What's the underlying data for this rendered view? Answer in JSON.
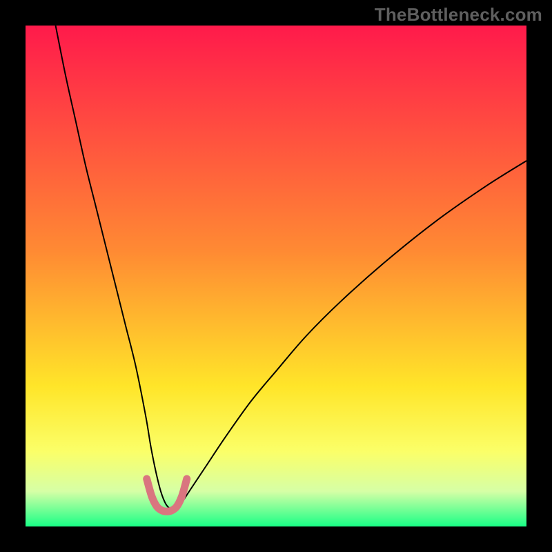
{
  "watermark": "TheBottleneck.com",
  "chart_data": {
    "type": "line",
    "title": "",
    "xlabel": "",
    "ylabel": "",
    "xlim": [
      0,
      100
    ],
    "ylim": [
      0,
      100
    ],
    "gradient_stops": [
      {
        "offset": 0,
        "color": "#ff1a4b"
      },
      {
        "offset": 45,
        "color": "#ff8a33"
      },
      {
        "offset": 72,
        "color": "#ffe529"
      },
      {
        "offset": 85,
        "color": "#fbff68"
      },
      {
        "offset": 93,
        "color": "#d6ffa6"
      },
      {
        "offset": 100,
        "color": "#19ff86"
      }
    ],
    "series": [
      {
        "name": "curve",
        "color": "#000000",
        "width": 2,
        "x": [
          6,
          8,
          10,
          12,
          14,
          16,
          18,
          20,
          22,
          24,
          25,
          26,
          27,
          28,
          29,
          30,
          31,
          33,
          36,
          40,
          45,
          50,
          56,
          63,
          72,
          82,
          92,
          100
        ],
        "y": [
          100,
          90,
          81,
          72,
          64,
          56,
          48,
          40,
          32,
          22,
          16,
          11,
          7,
          4.5,
          3.5,
          3.5,
          4.5,
          7.5,
          12,
          18,
          25,
          31,
          38,
          45,
          53,
          61,
          68,
          73
        ]
      },
      {
        "name": "highlight",
        "color": "#d9757f",
        "width": 11,
        "linecap": "round",
        "x": [
          24.2,
          25.2,
          26.2,
          27.2,
          28.2,
          29.2,
          30.2,
          31.2,
          32.2
        ],
        "y": [
          9.5,
          6.0,
          4.0,
          3.2,
          3.0,
          3.2,
          4.0,
          6.0,
          9.5
        ]
      }
    ]
  }
}
